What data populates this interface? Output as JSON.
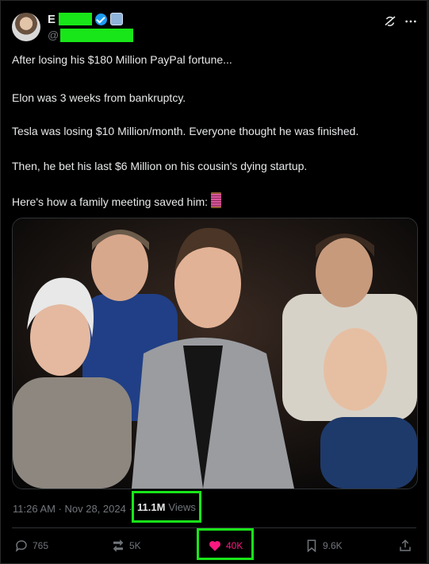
{
  "author": {
    "name_initial": "E",
    "handle_prefix": "@",
    "name_redacted": true,
    "handle_redacted": true,
    "verified": true
  },
  "icons": {
    "verified": "verified-badge-icon",
    "affiliation": "affiliation-badge-icon",
    "grok": "grok-icon",
    "more": "more-icon",
    "thread": "thread-spool-icon",
    "reply": "reply-icon",
    "repost": "repost-icon",
    "like": "heart-icon",
    "bookmark": "bookmark-icon",
    "share": "share-icon"
  },
  "post": {
    "lines": [
      "After losing his $180 Million PayPal fortune...",
      "Elon was 3 weeks from bankruptcy.",
      "Tesla was losing $10 Million/month. Everyone thought he was finished.",
      "Then, he bet his last $6 Million on his cousin's dying startup.",
      "Here's how a family meeting saved him:"
    ]
  },
  "meta": {
    "timestamp": "11:26 AM · Nov 28, 2024 ·",
    "views_count": "11.1M",
    "views_label": "Views"
  },
  "actions": {
    "replies": "765",
    "reposts": "5K",
    "likes": "40K",
    "bookmarks": "9.6K"
  },
  "colors": {
    "background": "#000000",
    "text": "#e7e9ea",
    "muted": "#71767b",
    "like": "#f91880",
    "highlight": "#19e619",
    "verified": "#1d9bf0"
  }
}
